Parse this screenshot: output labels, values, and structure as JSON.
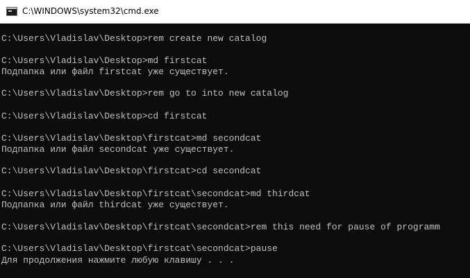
{
  "window": {
    "title": "C:\\WINDOWS\\system32\\cmd.exe",
    "icon": "console-app-icon"
  },
  "console": {
    "text_color": "#c0c0c0",
    "background_color": "#0c0c0c",
    "lines": [
      "C:\\Users\\Vladislav\\Desktop>rem create new catalog",
      "C:\\Users\\Vladislav\\Desktop>md firstcat",
      "Подпапка или файл firstcat уже существует.",
      "C:\\Users\\Vladislav\\Desktop>rem go to into new catalog",
      "C:\\Users\\Vladislav\\Desktop>cd firstcat",
      "C:\\Users\\Vladislav\\Desktop\\firstcat>md secondcat",
      "Подпапка или файл secondcat уже существует.",
      "C:\\Users\\Vladislav\\Desktop\\firstcat>cd secondcat",
      "C:\\Users\\Vladislav\\Desktop\\firstcat\\secondcat>md thirdcat",
      "Подпапка или файл thirdcat уже существует.",
      "C:\\Users\\Vladislav\\Desktop\\firstcat\\secondcat>rem this need for pause of programm",
      "C:\\Users\\Vladislav\\Desktop\\firstcat\\secondcat>pause",
      "Для продолжения нажмите любую клавишу . . ."
    ]
  }
}
